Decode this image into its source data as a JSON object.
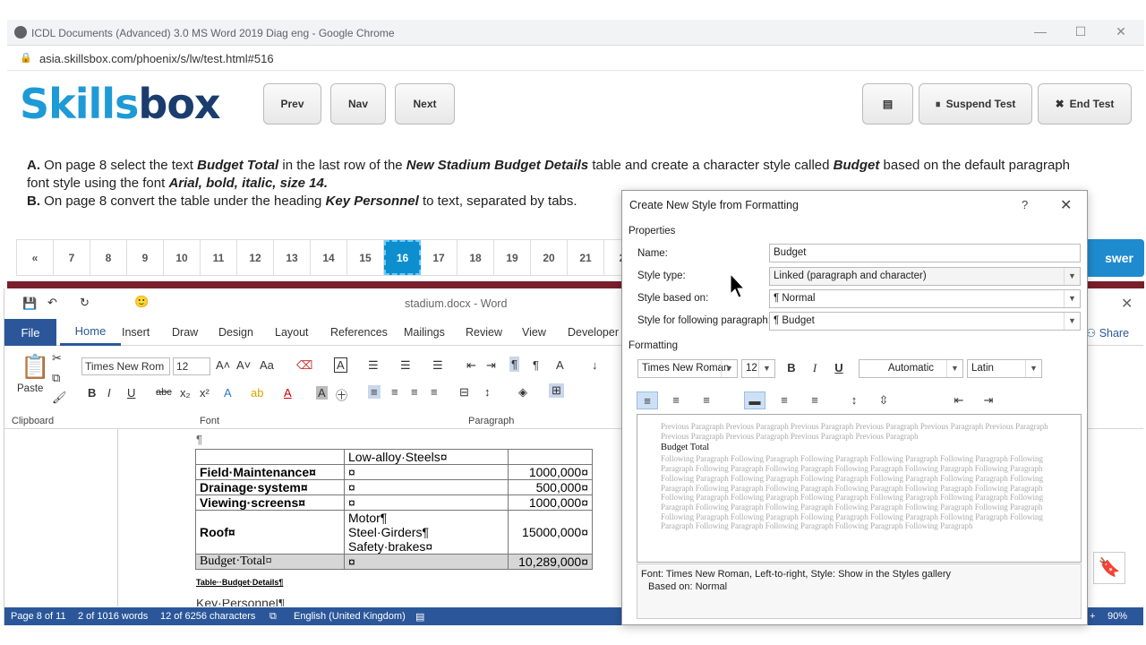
{
  "browser": {
    "title": "ICDL Documents (Advanced) 3.0 MS Word 2019 Diag eng - Google Chrome",
    "url": "asia.skillsbox.com/phoenix/s/lw/test.html#516",
    "controls": [
      "—",
      "☐",
      "✕"
    ]
  },
  "skillsbox": {
    "logo_a": "Skills",
    "logo_b": "box",
    "prev": "Prev",
    "nav": "Nav",
    "next": "Next",
    "suspend": "Suspend Test",
    "end": "End Test",
    "answer_fragment": "swer",
    "question": {
      "a_label": "A.",
      "a_text": "On page 8 select the text Budget Total in the last row of the New Stadium Budget Details table and create a character style called Budget based on the default paragraph font style using the font Arial, bold, italic, size 14.",
      "b_label": "B.",
      "b_text": "On page 8 convert the table under the heading Key Personnel to text, separated by tabs."
    },
    "pages": [
      "«",
      "7",
      "8",
      "9",
      "10",
      "11",
      "12",
      "13",
      "14",
      "15",
      "16",
      "17",
      "18",
      "19",
      "20",
      "21",
      "2"
    ],
    "current_page": "16"
  },
  "word": {
    "doc_title": "stadium.docx  -  Word",
    "tabs": [
      "File",
      "Home",
      "Insert",
      "Draw",
      "Design",
      "Layout",
      "References",
      "Mailings",
      "Review",
      "View",
      "Developer"
    ],
    "share": "Share",
    "font_name": "Times New Rom",
    "font_size": "12",
    "paste": "Paste",
    "groups": {
      "clipboard": "Clipboard",
      "font": "Font",
      "paragraph": "Paragraph"
    },
    "table": [
      {
        "c1": "",
        "c2": "Low-alloy·Steels¤",
        "c3": ""
      },
      {
        "c1": "Field·Maintenance¤",
        "c2": "¤",
        "c3": "1000,000¤"
      },
      {
        "c1": "Drainage·system¤",
        "c2": "¤",
        "c3": "500,000¤"
      },
      {
        "c1": "Viewing·screens¤",
        "c2": "¤",
        "c3": "1000,000¤"
      },
      {
        "c1": "Roof¤",
        "c2": "Motor¶\nSteel·Girders¶\nSafety·brakes¤",
        "c3": "15000,000¤"
      },
      {
        "c1": "Budget·Total¤",
        "c2": "¤",
        "c3": "10,289,000¤"
      }
    ],
    "caption": "Table··Budget·Details¶",
    "next_heading": "Key·Personnel¶",
    "status": {
      "page": "Page 8 of 11",
      "words": "2 of 1016 words",
      "chars": "12 of 6256 characters",
      "lang": "English (United Kingdom)",
      "zoom": "90%"
    }
  },
  "dialog": {
    "title": "Create New Style from Formatting",
    "help": "?",
    "close": "✕",
    "properties_label": "Properties",
    "name_label": "Name:",
    "name_value": "Budget",
    "type_label": "Style type:",
    "type_value": "Linked (paragraph and character)",
    "based_label": "Style based on:",
    "based_value": "¶ Normal",
    "following_label": "Style for following paragraph:",
    "following_value": "¶ Budget",
    "formatting_label": "Formatting",
    "font": "Times New Roman",
    "size": "12",
    "color": "Automatic",
    "script": "Latin",
    "preview_prev": "Previous Paragraph Previous Paragraph Previous Paragraph Previous Paragraph Previous Paragraph Previous Paragraph Previous Paragraph Previous Paragraph Previous Paragraph Previous Paragraph",
    "preview_main": "Budget Total",
    "preview_follow": "Following Paragraph Following Paragraph Following Paragraph Following Paragraph Following Paragraph Following Paragraph Following Paragraph Following Paragraph Following Paragraph Following Paragraph Following Paragraph Following Paragraph Following Paragraph Following Paragraph Following Paragraph Following Paragraph Following Paragraph Following Paragraph Following Paragraph Following Paragraph Following Paragraph Following Paragraph Following Paragraph Following Paragraph Following Paragraph Following Paragraph Following Paragraph Following Paragraph Following Paragraph Following Paragraph Following Paragraph Following Paragraph Following Paragraph Following Paragraph Following Paragraph Following Paragraph Following Paragraph Following Paragraph Following Paragraph Following Paragraph Following Paragraph Following Paragraph Following Paragraph",
    "desc_line1": "Font: Times New Roman, Left-to-right, Style: Show in the Styles gallery",
    "desc_line2": "Based on: Normal"
  }
}
